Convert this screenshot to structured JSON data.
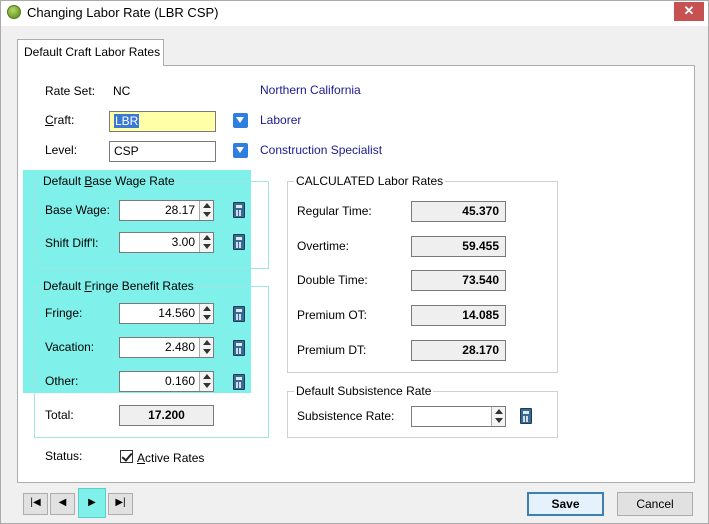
{
  "window": {
    "title": "Changing Labor Rate  (LBR CSP)",
    "close_label": "✕"
  },
  "tab": {
    "label": "Default Craft Labor Rates"
  },
  "header": {
    "rate_set_label": "Rate Set:",
    "rate_set_value": "NC",
    "rate_set_desc": "Northern California",
    "craft_label": "Craft:",
    "craft_value": "LBR",
    "craft_desc": "Laborer",
    "level_label": "Level:",
    "level_value": "CSP",
    "level_desc": "Construction Specialist"
  },
  "base_wage": {
    "title": "Default Base Wage Rate",
    "base_wage_label": "Base Wage:",
    "base_wage_value": "28.17",
    "shift_label": "Shift Diff'l:",
    "shift_value": "3.00"
  },
  "fringe": {
    "title": "Default Fringe Benefit Rates",
    "fringe_label": "Fringe:",
    "fringe_value": "14.560",
    "vacation_label": "Vacation:",
    "vacation_value": "2.480",
    "other_label": "Other:",
    "other_value": "0.160",
    "total_label": "Total:",
    "total_value": "17.200"
  },
  "calculated": {
    "title": "CALCULATED Labor Rates",
    "rows": [
      {
        "label": "Regular Time:",
        "value": "45.370"
      },
      {
        "label": "Overtime:",
        "value": "59.455"
      },
      {
        "label": "Double Time:",
        "value": "73.540"
      },
      {
        "label": "Premium OT:",
        "value": "14.085"
      },
      {
        "label": "Premium DT:",
        "value": "28.170"
      }
    ]
  },
  "subsistence": {
    "title": "Default Subsistence Rate",
    "label": "Subsistence Rate:",
    "value": ""
  },
  "status": {
    "label": "Status:",
    "checkbox_label": "Active Rates",
    "checked": true
  },
  "nav": {
    "first": "|◀",
    "prev": "◀",
    "next": "▶",
    "last": "▶|"
  },
  "buttons": {
    "save": "Save",
    "cancel": "Cancel"
  },
  "colors": {
    "highlight": "#80f0ea",
    "link_text": "#1a1a8c",
    "input_yellow": "#ffffa8"
  },
  "icons": [
    "app-icon",
    "close-icon",
    "dropdown-arrow-icon",
    "calculator-icon",
    "checkmark-icon"
  ]
}
